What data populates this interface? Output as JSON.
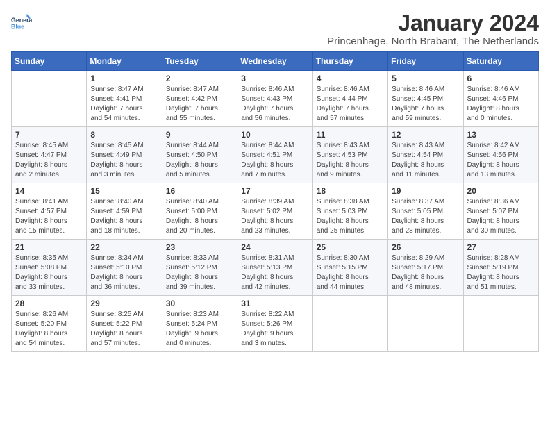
{
  "header": {
    "logo_line1": "General",
    "logo_line2": "Blue",
    "month": "January 2024",
    "location": "Princenhage, North Brabant, The Netherlands"
  },
  "days_of_week": [
    "Sunday",
    "Monday",
    "Tuesday",
    "Wednesday",
    "Thursday",
    "Friday",
    "Saturday"
  ],
  "weeks": [
    [
      {
        "day": "",
        "info": ""
      },
      {
        "day": "1",
        "info": "Sunrise: 8:47 AM\nSunset: 4:41 PM\nDaylight: 7 hours\nand 54 minutes."
      },
      {
        "day": "2",
        "info": "Sunrise: 8:47 AM\nSunset: 4:42 PM\nDaylight: 7 hours\nand 55 minutes."
      },
      {
        "day": "3",
        "info": "Sunrise: 8:46 AM\nSunset: 4:43 PM\nDaylight: 7 hours\nand 56 minutes."
      },
      {
        "day": "4",
        "info": "Sunrise: 8:46 AM\nSunset: 4:44 PM\nDaylight: 7 hours\nand 57 minutes."
      },
      {
        "day": "5",
        "info": "Sunrise: 8:46 AM\nSunset: 4:45 PM\nDaylight: 7 hours\nand 59 minutes."
      },
      {
        "day": "6",
        "info": "Sunrise: 8:46 AM\nSunset: 4:46 PM\nDaylight: 8 hours\nand 0 minutes."
      }
    ],
    [
      {
        "day": "7",
        "info": "Sunrise: 8:45 AM\nSunset: 4:47 PM\nDaylight: 8 hours\nand 2 minutes."
      },
      {
        "day": "8",
        "info": "Sunrise: 8:45 AM\nSunset: 4:49 PM\nDaylight: 8 hours\nand 3 minutes."
      },
      {
        "day": "9",
        "info": "Sunrise: 8:44 AM\nSunset: 4:50 PM\nDaylight: 8 hours\nand 5 minutes."
      },
      {
        "day": "10",
        "info": "Sunrise: 8:44 AM\nSunset: 4:51 PM\nDaylight: 8 hours\nand 7 minutes."
      },
      {
        "day": "11",
        "info": "Sunrise: 8:43 AM\nSunset: 4:53 PM\nDaylight: 8 hours\nand 9 minutes."
      },
      {
        "day": "12",
        "info": "Sunrise: 8:43 AM\nSunset: 4:54 PM\nDaylight: 8 hours\nand 11 minutes."
      },
      {
        "day": "13",
        "info": "Sunrise: 8:42 AM\nSunset: 4:56 PM\nDaylight: 8 hours\nand 13 minutes."
      }
    ],
    [
      {
        "day": "14",
        "info": "Sunrise: 8:41 AM\nSunset: 4:57 PM\nDaylight: 8 hours\nand 15 minutes."
      },
      {
        "day": "15",
        "info": "Sunrise: 8:40 AM\nSunset: 4:59 PM\nDaylight: 8 hours\nand 18 minutes."
      },
      {
        "day": "16",
        "info": "Sunrise: 8:40 AM\nSunset: 5:00 PM\nDaylight: 8 hours\nand 20 minutes."
      },
      {
        "day": "17",
        "info": "Sunrise: 8:39 AM\nSunset: 5:02 PM\nDaylight: 8 hours\nand 23 minutes."
      },
      {
        "day": "18",
        "info": "Sunrise: 8:38 AM\nSunset: 5:03 PM\nDaylight: 8 hours\nand 25 minutes."
      },
      {
        "day": "19",
        "info": "Sunrise: 8:37 AM\nSunset: 5:05 PM\nDaylight: 8 hours\nand 28 minutes."
      },
      {
        "day": "20",
        "info": "Sunrise: 8:36 AM\nSunset: 5:07 PM\nDaylight: 8 hours\nand 30 minutes."
      }
    ],
    [
      {
        "day": "21",
        "info": "Sunrise: 8:35 AM\nSunset: 5:08 PM\nDaylight: 8 hours\nand 33 minutes."
      },
      {
        "day": "22",
        "info": "Sunrise: 8:34 AM\nSunset: 5:10 PM\nDaylight: 8 hours\nand 36 minutes."
      },
      {
        "day": "23",
        "info": "Sunrise: 8:33 AM\nSunset: 5:12 PM\nDaylight: 8 hours\nand 39 minutes."
      },
      {
        "day": "24",
        "info": "Sunrise: 8:31 AM\nSunset: 5:13 PM\nDaylight: 8 hours\nand 42 minutes."
      },
      {
        "day": "25",
        "info": "Sunrise: 8:30 AM\nSunset: 5:15 PM\nDaylight: 8 hours\nand 44 minutes."
      },
      {
        "day": "26",
        "info": "Sunrise: 8:29 AM\nSunset: 5:17 PM\nDaylight: 8 hours\nand 48 minutes."
      },
      {
        "day": "27",
        "info": "Sunrise: 8:28 AM\nSunset: 5:19 PM\nDaylight: 8 hours\nand 51 minutes."
      }
    ],
    [
      {
        "day": "28",
        "info": "Sunrise: 8:26 AM\nSunset: 5:20 PM\nDaylight: 8 hours\nand 54 minutes."
      },
      {
        "day": "29",
        "info": "Sunrise: 8:25 AM\nSunset: 5:22 PM\nDaylight: 8 hours\nand 57 minutes."
      },
      {
        "day": "30",
        "info": "Sunrise: 8:23 AM\nSunset: 5:24 PM\nDaylight: 9 hours\nand 0 minutes."
      },
      {
        "day": "31",
        "info": "Sunrise: 8:22 AM\nSunset: 5:26 PM\nDaylight: 9 hours\nand 3 minutes."
      },
      {
        "day": "",
        "info": ""
      },
      {
        "day": "",
        "info": ""
      },
      {
        "day": "",
        "info": ""
      }
    ]
  ]
}
